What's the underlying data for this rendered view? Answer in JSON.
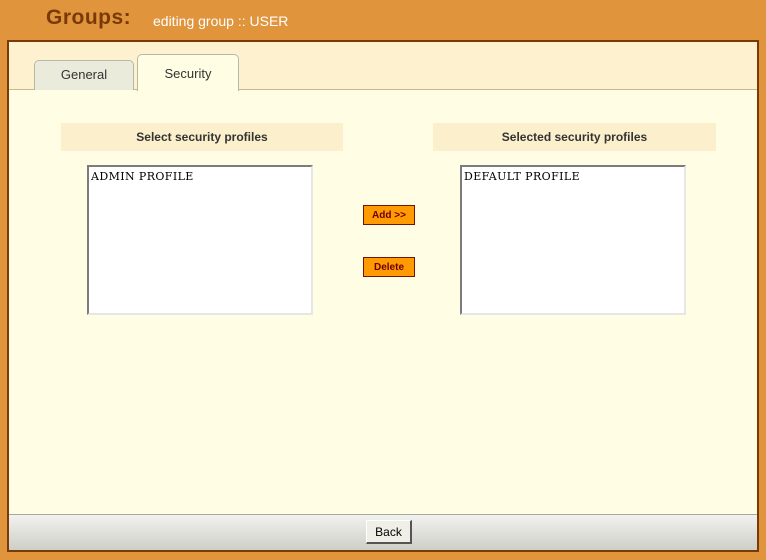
{
  "header": {
    "title": "Groups:",
    "subtitle": "editing group :: USER"
  },
  "tabs": [
    {
      "label": "General",
      "active": false
    },
    {
      "label": "Security",
      "active": true
    }
  ],
  "available": {
    "label": "Select security profiles",
    "items": [
      "ADMIN PROFILE"
    ]
  },
  "selected": {
    "label": "Selected security profiles",
    "items": [
      "DEFAULT PROFILE"
    ]
  },
  "actions": {
    "add_label": "Add >>",
    "delete_label": "Delete"
  },
  "footer": {
    "back_label": "Back"
  },
  "colors": {
    "header_bg": "#e0943c",
    "title": "#7a3a08",
    "panel_bg": "#fffde4",
    "button_bg": "#ff9a00"
  }
}
